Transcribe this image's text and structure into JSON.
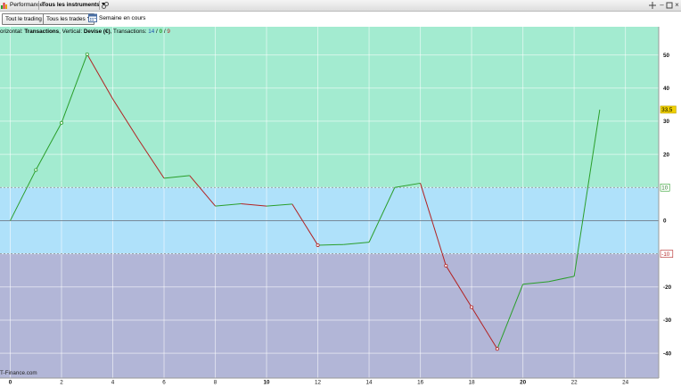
{
  "titlebar": {
    "tab_performance": "Performance",
    "tab_instruments": "Tous les instruments"
  },
  "toolbar": {
    "filter_trading": "Tout le trading",
    "filter_trades": "Tous les trades",
    "period": "Semaine en cours"
  },
  "legend": {
    "prefix": "orizontal: ",
    "h_value": "Transactions",
    "mid": ", Vertical: ",
    "v_value": "Devise (€)",
    "tail": ", Transactions: ",
    "count_total": "14",
    "count_sep1": " / ",
    "count_win": "0",
    "count_sep2": " / ",
    "count_loss": "9"
  },
  "watermark": "T-Finance.com",
  "colors": {
    "zone_top": "#a3ebd0",
    "zone_mid": "#afe1fa",
    "zone_bottom": "#b2b6d7",
    "up_line": "#2a9e2a",
    "down_line": "#b22222",
    "last_badge": "#f0d000"
  },
  "chart_data": {
    "type": "line",
    "x": [
      0,
      1,
      2,
      3,
      4,
      5,
      6,
      7,
      8,
      9,
      10,
      11,
      12,
      13,
      14,
      15,
      16,
      17,
      18,
      19,
      20,
      21,
      22,
      23
    ],
    "y": [
      0,
      15.3,
      29.5,
      50.2,
      36.7,
      24.5,
      12.8,
      13.6,
      4.4,
      5.1,
      4.4,
      5.0,
      -7.4,
      -7.2,
      -6.5,
      10.0,
      11.3,
      -13.6,
      -26.1,
      -38.7,
      -19.2,
      -18.4,
      -16.8,
      33.5
    ],
    "markers_at": [
      1,
      2,
      3,
      12,
      17,
      18,
      19
    ],
    "xlim": [
      -0.4,
      25.3
    ],
    "ylim": [
      -47.5,
      58.5
    ],
    "x_ticks": [
      "0",
      "2",
      "4",
      "6",
      "8",
      "10",
      "12",
      "14",
      "16",
      "18",
      "20",
      "22",
      "24"
    ],
    "x_tick_values": [
      0,
      2,
      4,
      6,
      8,
      10,
      12,
      14,
      16,
      18,
      20,
      22,
      24
    ],
    "x_bold_ticks": [
      0,
      10,
      20
    ],
    "y_ticks": [
      "50",
      "40",
      "30",
      "20",
      "10",
      "0",
      "-10",
      "-20",
      "-30",
      "-40"
    ],
    "y_tick_values": [
      50,
      40,
      30,
      20,
      10,
      0,
      -10,
      -20,
      -30,
      -40
    ],
    "upper_band": 10,
    "lower_band": -10,
    "upper_band_label": "10",
    "lower_band_label": "-10",
    "last_value_label": "33,5",
    "last_value": 33.5,
    "grid": true
  }
}
